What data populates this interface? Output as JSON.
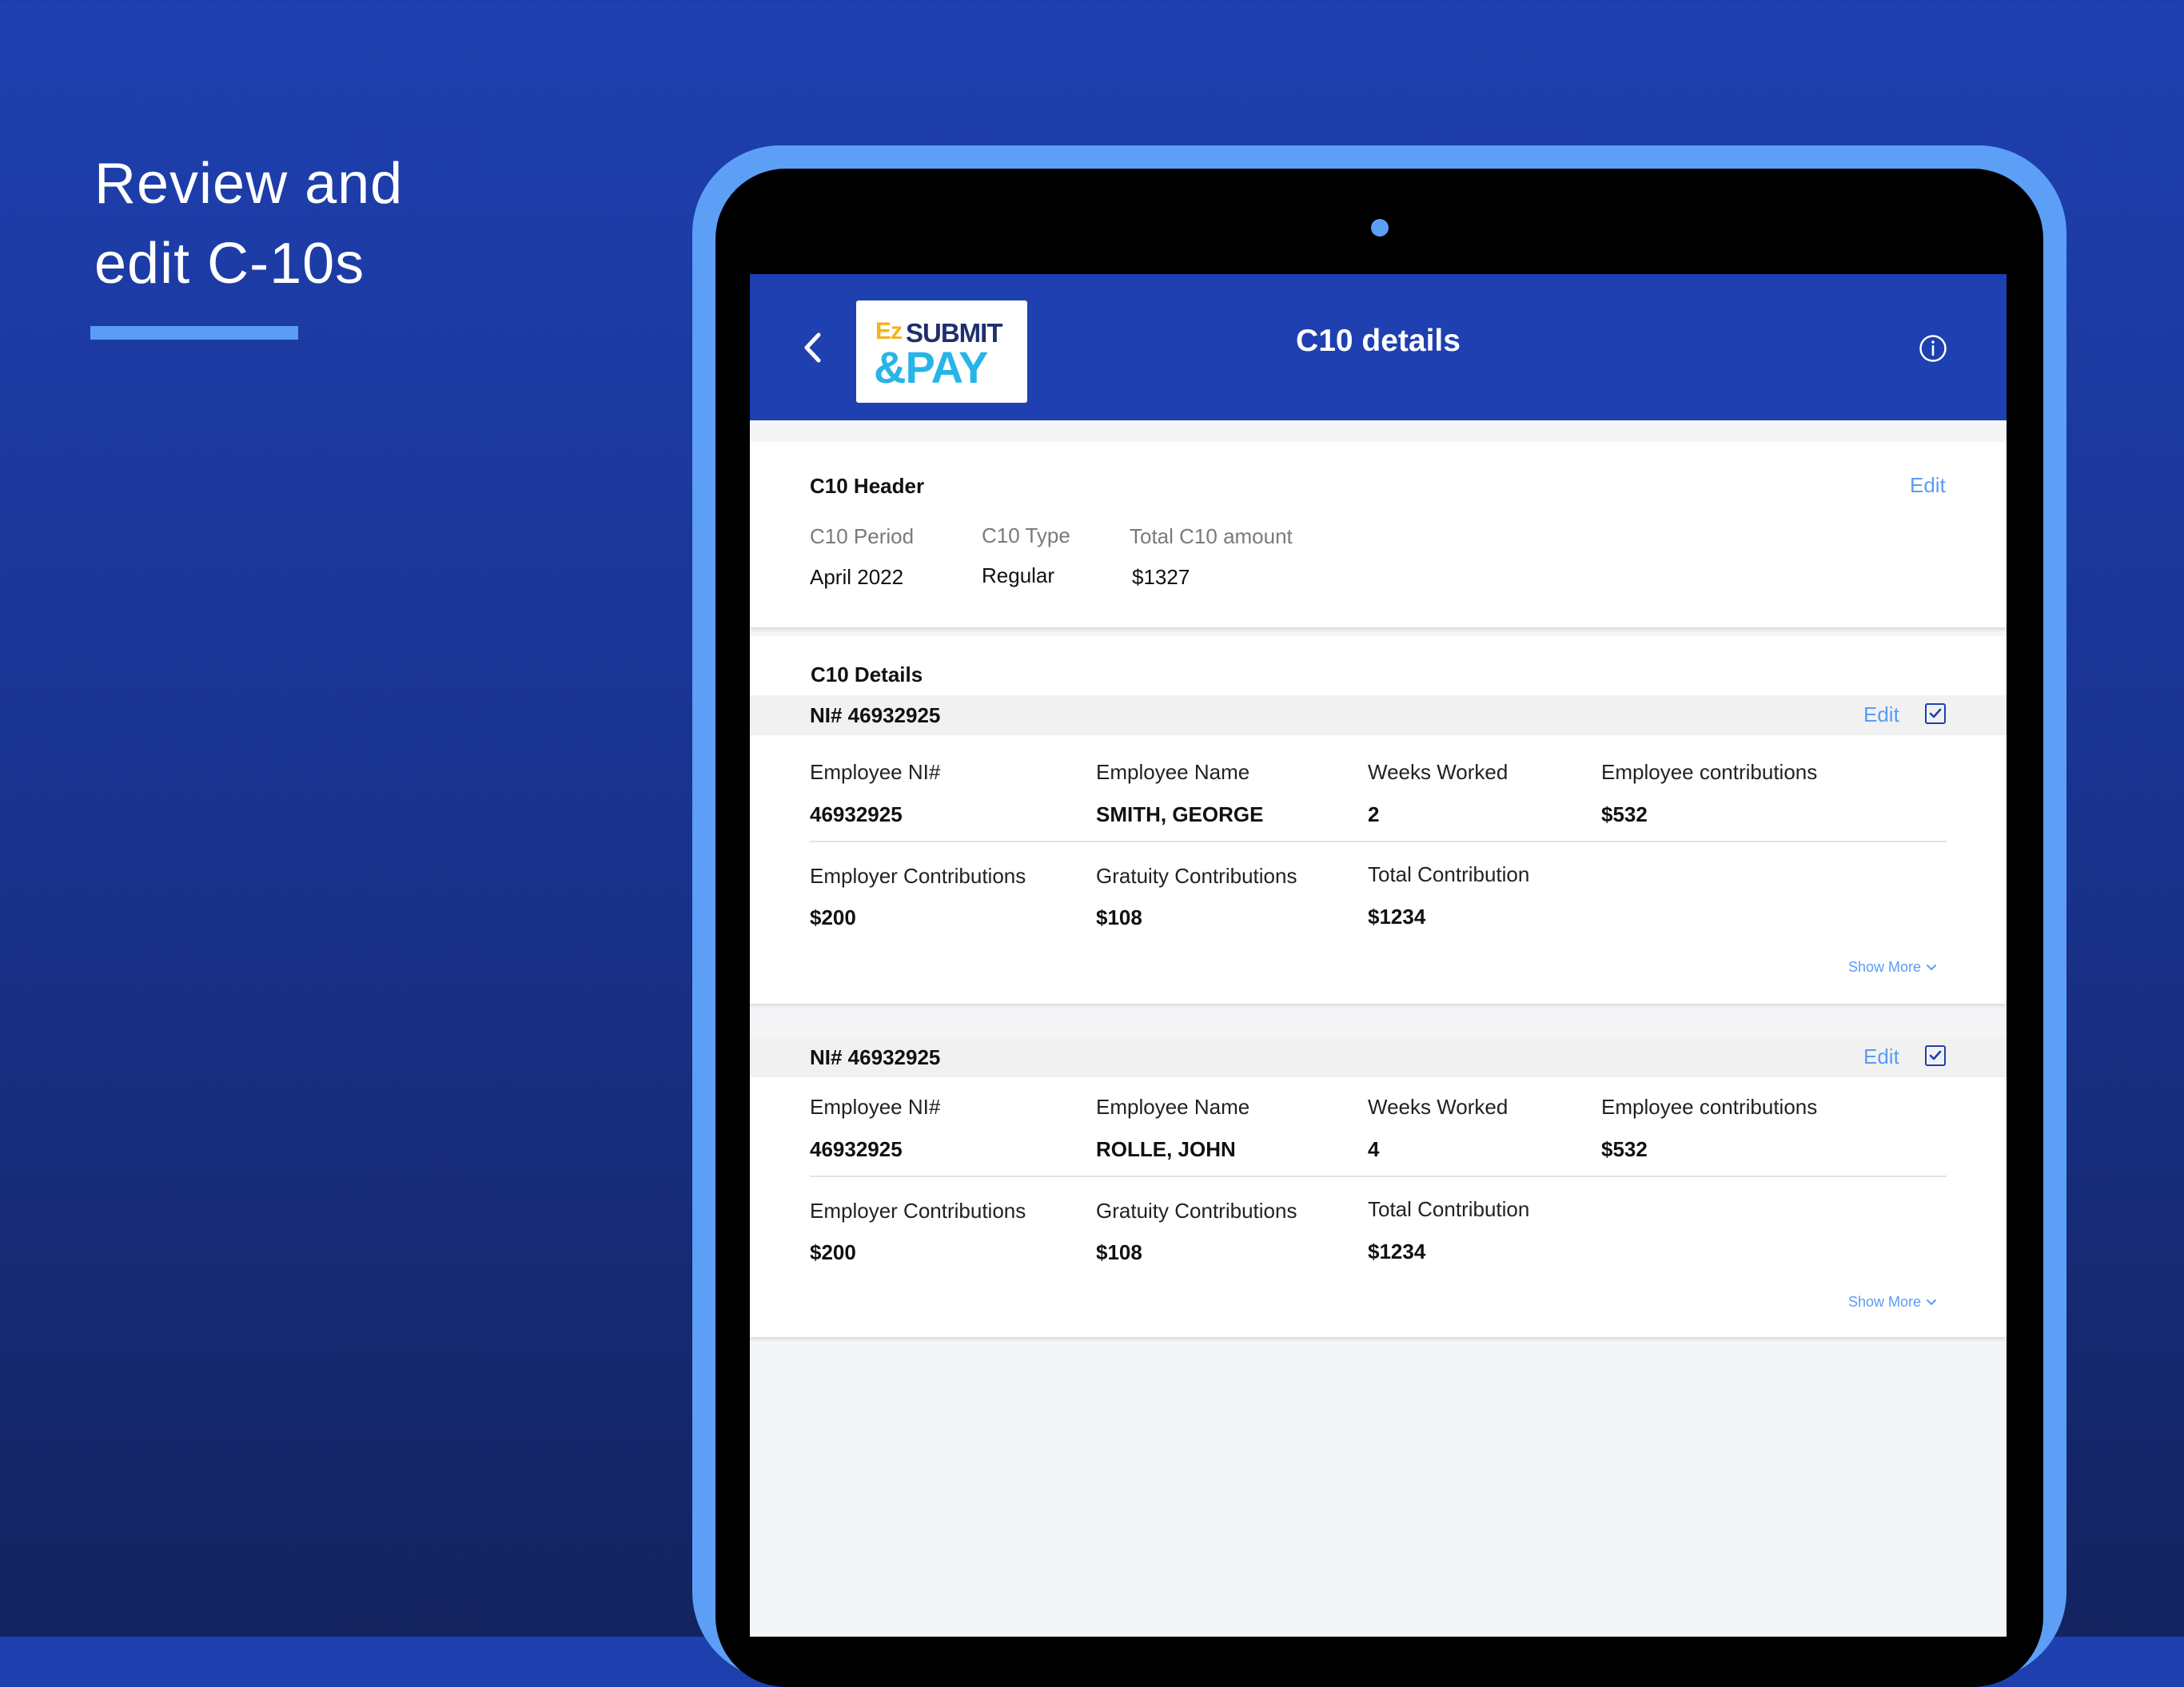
{
  "promo": {
    "title_line1": "Review and",
    "title_line2": "edit C-10s",
    "underline_color": "#5a9cf5"
  },
  "app": {
    "header_title": "C10 details",
    "header_color": "#1e40b0",
    "logo": {
      "ez": "Ez",
      "submit": "SUBMIT",
      "pay": "&PAY"
    },
    "icons": {
      "back": "chevron-left-icon",
      "info": "info-icon"
    }
  },
  "c10_header": {
    "section_title": "C10 Header",
    "edit_label": "Edit",
    "fields": [
      {
        "label": "C10 Period",
        "value": "April 2022"
      },
      {
        "label": "C10 Type",
        "value": "Regular"
      },
      {
        "label": "Total C10 amount",
        "value": "$1327"
      }
    ]
  },
  "c10_details": {
    "section_title": "C10 Details",
    "records": [
      {
        "id_label": "NI# 46932925",
        "edit_label": "Edit",
        "checked": true,
        "row1": [
          {
            "label": "Employee NI#",
            "value": "46932925"
          },
          {
            "label": "Employee Name",
            "value": "SMITH, GEORGE"
          },
          {
            "label": "Weeks Worked",
            "value": "2"
          },
          {
            "label": "Employee contributions",
            "value": "$532"
          }
        ],
        "row2": [
          {
            "label": "Employer Contributions",
            "value": "$200"
          },
          {
            "label": "Gratuity Contributions",
            "value": "$108"
          },
          {
            "label": "Total Contribution",
            "value": "$1234"
          }
        ],
        "show_more": "Show More"
      },
      {
        "id_label": "NI# 46932925",
        "edit_label": "Edit",
        "checked": true,
        "row1": [
          {
            "label": "Employee NI#",
            "value": "46932925"
          },
          {
            "label": "Employee Name",
            "value": "ROLLE, JOHN"
          },
          {
            "label": "Weeks Worked",
            "value": "4"
          },
          {
            "label": "Employee contributions",
            "value": "$532"
          }
        ],
        "row2": [
          {
            "label": "Employer Contributions",
            "value": "$200"
          },
          {
            "label": "Gratuity Contributions",
            "value": "$108"
          },
          {
            "label": "Total Contribution",
            "value": "$1234"
          }
        ],
        "show_more": "Show More"
      }
    ]
  }
}
